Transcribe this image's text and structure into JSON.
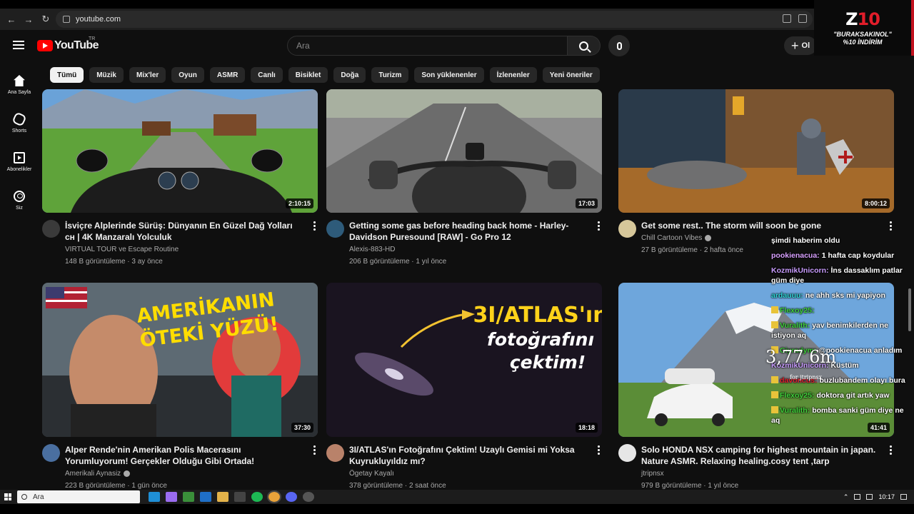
{
  "browser": {
    "url": "youtube.com"
  },
  "sponsor": {
    "logo_main": "Z",
    "logo_accent": "10",
    "code_line1": "\"BURAKSAKINOL\"",
    "code_line2": "%10 İNDİRİM"
  },
  "masthead": {
    "logo_text": "YouTube",
    "country": "TR",
    "search_placeholder": "Ara",
    "create_label": "Ol"
  },
  "chips": [
    {
      "label": "Tümü",
      "active": true
    },
    {
      "label": "Müzik"
    },
    {
      "label": "Mix'ler"
    },
    {
      "label": "Oyun"
    },
    {
      "label": "ASMR"
    },
    {
      "label": "Canlı"
    },
    {
      "label": "Bisiklet"
    },
    {
      "label": "Doğa"
    },
    {
      "label": "Turizm"
    },
    {
      "label": "Son yüklenenler"
    },
    {
      "label": "İzlenenler"
    },
    {
      "label": "Yeni öneriler"
    }
  ],
  "rail": [
    {
      "label": "Ana Sayfa",
      "icon": "home-icon"
    },
    {
      "label": "Shorts",
      "icon": "shorts-icon"
    },
    {
      "label": "Abonelikler",
      "icon": "subscriptions-icon"
    },
    {
      "label": "Siz",
      "icon": "you-icon"
    }
  ],
  "videos": [
    {
      "title": "İsviçre Alplerinde Sürüş: Dünyanın En Güzel Dağ Yolları ᴄʜ | 4K Manzaralı Yolculuk",
      "channel": "VIRTUAL TOUR ve Escape Routine",
      "verified": false,
      "views": "148 B görüntüleme",
      "age": "3 ay önce",
      "duration": "2:10:15"
    },
    {
      "title": "Getting some gas before heading back home - Harley-Davidson Puresound [RAW] - Go Pro 12",
      "channel": "Alexis-883-HD",
      "verified": false,
      "views": "206 B görüntüleme",
      "age": "1 yıl önce",
      "duration": "17:03"
    },
    {
      "title": "Get some rest.. The storm will soon be gone",
      "channel": "Chill Cartoon Vibes",
      "verified": true,
      "views": "27 B görüntüleme",
      "age": "2 hafta önce",
      "duration": "8:00:12"
    },
    {
      "title": "Alper Rende'nin Amerikan Polis Macerasını Yorumluyorum! Gerçekler Olduğu Gibi Ortada!",
      "channel": "Amerikali Aynasiz",
      "verified": true,
      "views": "223 B görüntüleme",
      "age": "1 gün önce",
      "duration": "37:30",
      "thumb_text1": "AMERİKANIN",
      "thumb_text2": "ÖTEKİ YÜZÜ!"
    },
    {
      "title": "3I/ATLAS'ın Fotoğrafını Çektim! Uzaylı Gemisi mi Yoksa Kuyrukluyıldız mı?",
      "channel": "Ögetay Kayalı",
      "verified": false,
      "views": "378 görüntüleme",
      "age": "2 saat önce",
      "duration": "18:18",
      "thumb_text1": "3I/ATLAS'ın",
      "thumb_text2": "fotoğrafını",
      "thumb_text3": "çektim!"
    },
    {
      "title": "Solo HONDA NSX camping for highest mountain in japan. Nature ASMR. Relaxing healing.cosy tent ,tarp",
      "channel": "jtripnsx",
      "verified": false,
      "views": "979 B görüntüleme",
      "age": "1 yıl önce",
      "duration": "41:41"
    }
  ],
  "chat": [
    {
      "user": "",
      "text": "şimdi haberim oldu",
      "color": "#ffffff"
    },
    {
      "user": "pookienacua:",
      "text": "1 hafta cap koydular",
      "color": "#d8a0ff"
    },
    {
      "user": "KozmikUnicorn:",
      "text": "İns dassaklım patlar güm diye",
      "color": "#c99cff"
    },
    {
      "user": "ardauuu:",
      "text": "ne ahh sks mi yapiyon",
      "color": "#2fd3d6"
    },
    {
      "user": "Flexoy25:",
      "text": "",
      "color": "#3fd13a",
      "badge": true
    },
    {
      "user": "Vuralith:",
      "text": "yav benimkilerden ne istiyon aq",
      "color": "#3fd13a",
      "badge": true
    },
    {
      "user": "Ciyradym:",
      "text": "@pookienacua anladım",
      "color": "#3fd13a",
      "badge": true
    },
    {
      "user": "KozmikUnicorn:",
      "text": "Küstüm",
      "color": "#c99cff"
    },
    {
      "user": "davoncus:",
      "text": "buzlubandem olayı bura",
      "color": "#e0202a",
      "badge": true
    },
    {
      "user": "Flexoy25:",
      "text": "doktora git artık yaw",
      "color": "#3fd13a",
      "badge": true
    },
    {
      "user": "Vuralith:",
      "text": "bomba sanki güm diye ne aq",
      "color": "#3fd13a",
      "badge": true
    }
  ],
  "overlay_clock": "3,77 6m",
  "overlay_clock_sub": "for jtripnsx",
  "taskbar": {
    "search_label": "Ara",
    "time": "10:17"
  },
  "colors": {
    "accent_red": "#ff0000",
    "background": "#0f0f0f",
    "chip_bg": "#272727"
  }
}
